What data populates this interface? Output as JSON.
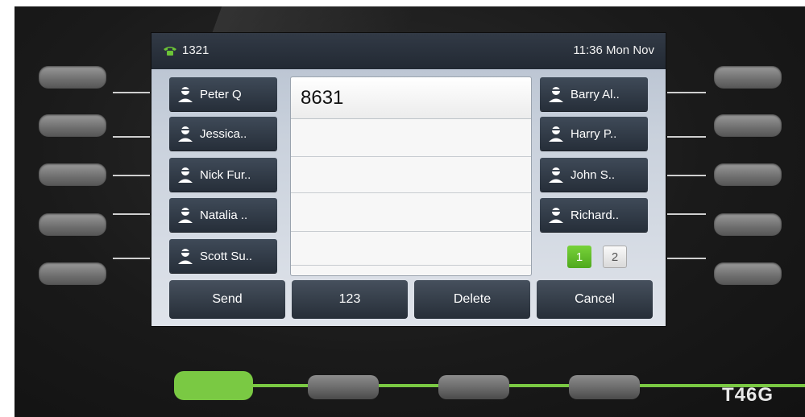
{
  "statusbar": {
    "extension": "1321",
    "datetime": "11:36 Mon Nov"
  },
  "dial": {
    "number": "8631"
  },
  "contacts_left": [
    {
      "label": "Peter Q"
    },
    {
      "label": "Jessica.."
    },
    {
      "label": "Nick Fur.."
    },
    {
      "label": "Natalia .."
    },
    {
      "label": "Scott Su.."
    }
  ],
  "contacts_right": [
    {
      "label": "Barry Al.."
    },
    {
      "label": "Harry P.."
    },
    {
      "label": "John S.."
    },
    {
      "label": "Richard.."
    }
  ],
  "pages": {
    "current": "1",
    "next": "2"
  },
  "softkeys": {
    "send": "Send",
    "mode": "123",
    "delete": "Delete",
    "cancel": "Cancel"
  },
  "device": {
    "model": "T46G"
  },
  "colors": {
    "accent": "#7ac943",
    "key_bg": "#2e3642",
    "screen_bg": "#c9d1dc"
  }
}
